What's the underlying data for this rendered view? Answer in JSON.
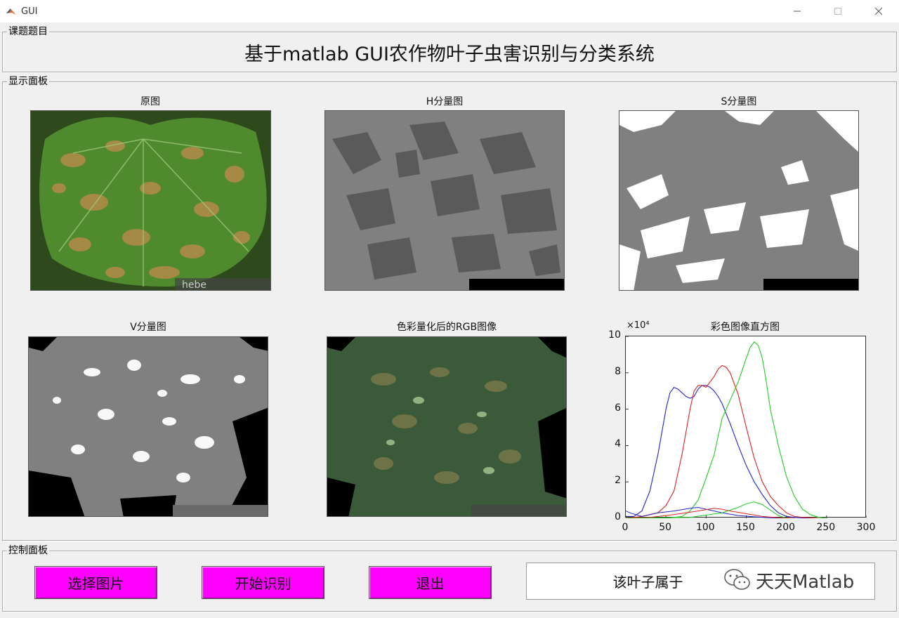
{
  "window": {
    "title": "GUI"
  },
  "topic_panel": {
    "legend": "课题题目",
    "title": "基于matlab GUI农作物叶子虫害识别与分类系统"
  },
  "display_panel": {
    "legend": "显示面板",
    "axes": [
      {
        "title": "原图"
      },
      {
        "title": "H分量图"
      },
      {
        "title": "S分量图"
      },
      {
        "title": "V分量图"
      },
      {
        "title": "色彩量化后的RGB图像"
      },
      {
        "title": "彩色图像直方图"
      }
    ]
  },
  "chart_data": {
    "type": "line",
    "title": "彩色图像直方图",
    "xlabel": "",
    "ylabel": "",
    "xlim": [
      0,
      300
    ],
    "ylim": [
      0,
      10
    ],
    "y_exponent_label": "×10⁴",
    "xticks": [
      0,
      50,
      100,
      150,
      200,
      250,
      300
    ],
    "yticks": [
      0,
      2,
      4,
      6,
      8,
      10
    ],
    "grid": false,
    "series": [
      {
        "color": "#2222cc",
        "x": [
          0,
          10,
          20,
          30,
          40,
          50,
          55,
          60,
          65,
          70,
          75,
          80,
          85,
          90,
          95,
          100,
          105,
          110,
          115,
          120,
          130,
          140,
          150,
          160,
          170,
          180,
          190,
          200,
          210,
          220,
          230
        ],
        "y": [
          0.1,
          0.1,
          0.4,
          1.5,
          3.5,
          6.0,
          6.9,
          7.2,
          7.1,
          6.9,
          6.7,
          6.6,
          6.7,
          7.1,
          7.3,
          7.3,
          7.2,
          7.0,
          6.7,
          6.3,
          5.2,
          4.0,
          2.9,
          2.0,
          1.3,
          0.7,
          0.3,
          0.1,
          0.05,
          0.02,
          0
        ]
      },
      {
        "color": "#dd2222",
        "x": [
          0,
          20,
          40,
          50,
          60,
          70,
          80,
          85,
          90,
          95,
          100,
          110,
          115,
          120,
          125,
          130,
          140,
          150,
          160,
          170,
          180,
          190,
          200,
          210,
          220,
          230,
          240
        ],
        "y": [
          0,
          0.1,
          0.3,
          0.7,
          1.5,
          3.5,
          6.0,
          7.0,
          7.3,
          7.3,
          7.2,
          7.8,
          8.2,
          8.4,
          8.3,
          8.0,
          6.8,
          5.0,
          3.3,
          2.0,
          1.2,
          0.7,
          0.3,
          0.1,
          0.05,
          0.02,
          0
        ]
      },
      {
        "color": "#22cc22",
        "x": [
          0,
          50,
          70,
          80,
          90,
          100,
          110,
          115,
          120,
          130,
          140,
          150,
          155,
          160,
          165,
          170,
          175,
          180,
          190,
          200,
          210,
          220,
          230,
          240,
          250
        ],
        "y": [
          0,
          0,
          0.1,
          0.4,
          1.0,
          2.2,
          3.5,
          4.5,
          5.5,
          6.5,
          7.5,
          8.8,
          9.4,
          9.7,
          9.5,
          8.8,
          7.5,
          6.0,
          4.0,
          2.3,
          1.2,
          0.5,
          0.2,
          0.05,
          0
        ]
      }
    ],
    "minor_series": [
      {
        "color": "#2222cc",
        "x": [
          0,
          5,
          20,
          40,
          60,
          80,
          90,
          95,
          100,
          120,
          140,
          160,
          180,
          200
        ],
        "y": [
          0.4,
          0.3,
          0.1,
          0.3,
          0.4,
          0.55,
          0.6,
          0.55,
          0.5,
          0.3,
          0.15,
          0.08,
          0.03,
          0
        ]
      },
      {
        "color": "#dd2222",
        "x": [
          0,
          30,
          60,
          90,
          110,
          120,
          130,
          150,
          170,
          190,
          210
        ],
        "y": [
          0,
          0.05,
          0.2,
          0.4,
          0.55,
          0.5,
          0.4,
          0.25,
          0.1,
          0.03,
          0
        ]
      },
      {
        "color": "#22cc22",
        "x": [
          0,
          80,
          120,
          140,
          150,
          160,
          170,
          180,
          190,
          200
        ],
        "y": [
          0,
          0.05,
          0.3,
          0.6,
          0.8,
          0.9,
          0.75,
          0.45,
          0.15,
          0
        ]
      }
    ]
  },
  "control_panel": {
    "legend": "控制面板",
    "buttons": {
      "select": "选择图片",
      "start": "开始识别",
      "exit": "退出"
    },
    "result_text": "该叶子属于"
  },
  "watermark": {
    "text": "天天Matlab"
  },
  "colors": {
    "button_bg": "#ff00ff",
    "panel_bg": "#f0f0f0"
  }
}
